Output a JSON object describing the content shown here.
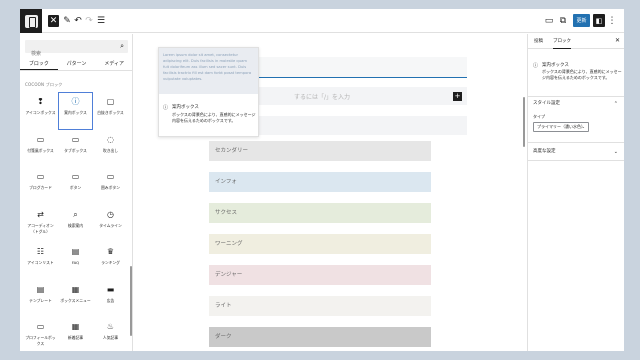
{
  "toolbar": {
    "add_icon": "plus-icon",
    "edit_icon": "pencil-icon",
    "undo_icon": "undo-icon",
    "redo_icon": "redo-icon",
    "outline_icon": "list-view-icon",
    "save_label": "更新",
    "icons": {
      "add": "✕",
      "edit": "✎",
      "undo": "↶",
      "redo": "↷",
      "list": "☰",
      "desktop": "▭",
      "external": "⧉",
      "settings": "◧",
      "more": "⋮"
    }
  },
  "inserter": {
    "search_placeholder": "検索",
    "tabs": [
      "ブロック",
      "パターン",
      "メディア"
    ],
    "category_title": "COCOON ブロック",
    "blocks": [
      {
        "label": "アイコンボックス",
        "icon": "❢",
        "active": false
      },
      {
        "label": "案内ボックス",
        "icon": "ⓘ",
        "active": true
      },
      {
        "label": "白抜きボックス",
        "icon": "▢",
        "active": false
      },
      {
        "label": "付箋風ボックス",
        "icon": "▭",
        "active": false
      },
      {
        "label": "タブボックス",
        "icon": "▭",
        "active": false
      },
      {
        "label": "吹き出し",
        "icon": "◌",
        "active": false
      },
      {
        "label": "ブログカード",
        "icon": "▭",
        "active": false
      },
      {
        "label": "ボタン",
        "icon": "▭",
        "active": false
      },
      {
        "label": "囲みボタン",
        "icon": "▭",
        "active": false
      },
      {
        "label": "アコーディオン（トグル）",
        "icon": "⇄",
        "active": false
      },
      {
        "label": "検索案内",
        "icon": "⌕",
        "active": false
      },
      {
        "label": "タイムライン",
        "icon": "◷",
        "active": false
      },
      {
        "label": "アイコンリスト",
        "icon": "☷",
        "active": false
      },
      {
        "label": "FAQ",
        "icon": "▤",
        "active": false
      },
      {
        "label": "ランキング",
        "icon": "♛",
        "active": false
      },
      {
        "label": "テンプレート",
        "icon": "▤",
        "active": false
      },
      {
        "label": "ボックスメニュー",
        "icon": "▦",
        "active": false
      },
      {
        "label": "広告",
        "icon": "▬",
        "active": false
      },
      {
        "label": "プロフィールボックス",
        "icon": "▭",
        "active": false
      },
      {
        "label": "新着記事",
        "icon": "▦",
        "active": false
      },
      {
        "label": "人気記事",
        "icon": "♨",
        "active": false
      }
    ]
  },
  "preview": {
    "lorem": "Lorem ipsum dolor sit amet, consectetur adipiscing elit. Duis facilisis in molestie quam fuit dolorifeum ass illum sed sacer sunt. Duis facilisis tractrix fill est dam forbt posat tempora vulputate voluptates.",
    "title": "案内ボックス",
    "description": "ボックスの背景色により、直感的にメッセージ内容を伝えるためのボックスです。"
  },
  "canvas": {
    "append_hint": "するには「/」を入力",
    "color_boxes": [
      {
        "label": "セカンダリー",
        "bg": "#e6e6e6"
      },
      {
        "label": "インフォ",
        "bg": "#dbe7f0"
      },
      {
        "label": "サクセス",
        "bg": "#e5ecdc"
      },
      {
        "label": "ワーニング",
        "bg": "#f0eee0"
      },
      {
        "label": "デンジャー",
        "bg": "#f0e1e3"
      },
      {
        "label": "ライト",
        "bg": "#f3f2ef"
      },
      {
        "label": "ダーク",
        "bg": "#c9c9c9"
      }
    ]
  },
  "settings": {
    "tabs": [
      "投稿",
      "ブロック"
    ],
    "close_icon": "✕",
    "block_title": "案内ボックス",
    "block_desc": "ボックスの背景色により、直感的にメッセージ内容を伝えるためのボックスです。",
    "style_panel": "スタイル設定",
    "type_label": "タイプ",
    "type_value": "プライマリー（濃い水色）",
    "advanced_panel": "高度な設定"
  },
  "colors": {
    "accent": "#2271b1",
    "dark": "#1e1e1e"
  }
}
